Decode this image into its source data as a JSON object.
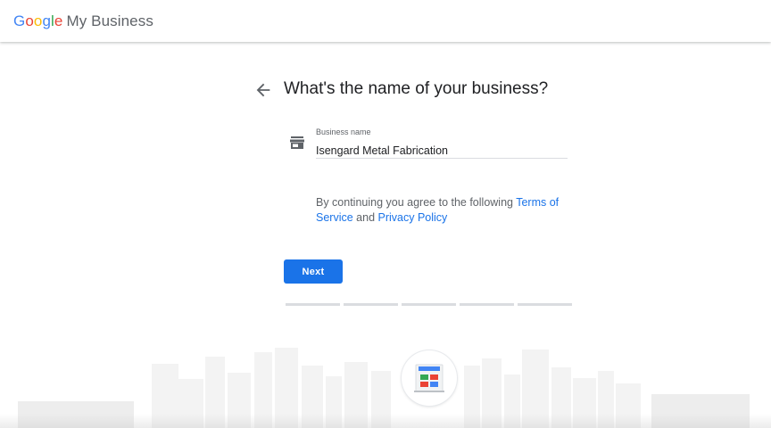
{
  "header": {
    "logo_google": [
      "G",
      "o",
      "o",
      "g",
      "l",
      "e"
    ],
    "logo_colors": [
      "#4285F4",
      "#EA4335",
      "#FBBC05",
      "#4285F4",
      "#34A853",
      "#EA4335"
    ],
    "product_name": "My Business"
  },
  "page": {
    "back_icon": "arrow-back-icon",
    "title": "What's the name of your business?"
  },
  "form": {
    "field_icon": "storefront-icon",
    "business_name_label": "Business name",
    "business_name_value": "Isengard Metal Fabrication"
  },
  "terms": {
    "prefix": "By continuing you agree to the following ",
    "terms_link": "Terms of Service",
    "conjunction": " and ",
    "privacy_link": "Privacy Policy"
  },
  "actions": {
    "next_label": "Next"
  },
  "progress": {
    "total_steps": 5,
    "current_step": 0
  },
  "colors": {
    "accent": "#1a73e8",
    "text_primary": "#202124",
    "text_secondary": "#5f6368",
    "divider": "#dadce0"
  }
}
